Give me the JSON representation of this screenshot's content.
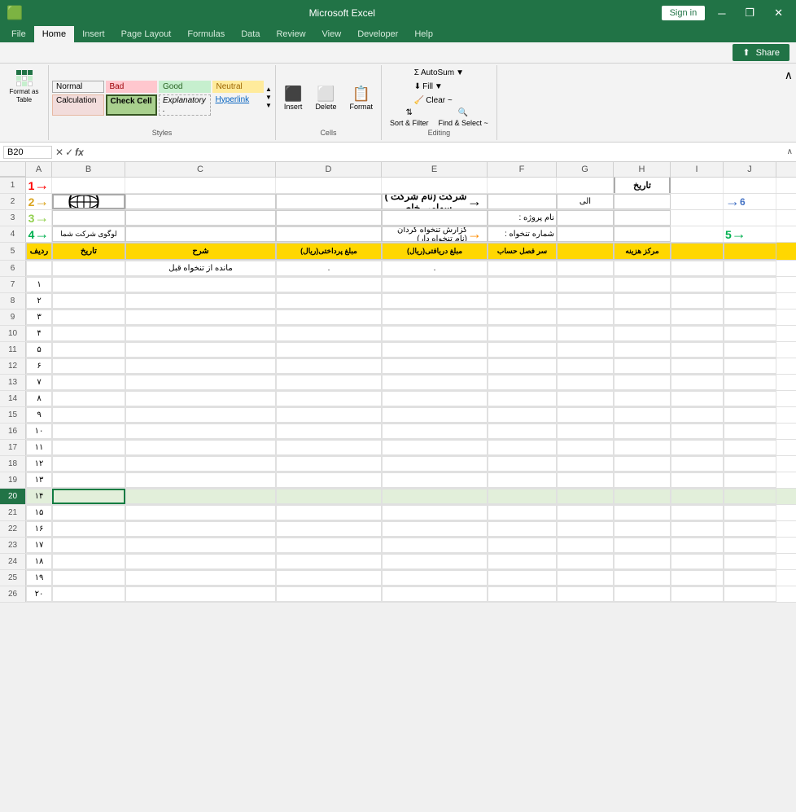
{
  "titlebar": {
    "app": "Microsoft Excel",
    "sign_in": "Sign in",
    "minimize": "─",
    "restore": "❐",
    "close": "✕"
  },
  "ribbon": {
    "tabs": [
      "File",
      "Home",
      "Insert",
      "Page Layout",
      "Formulas",
      "Data",
      "Review",
      "View",
      "Developer",
      "Help"
    ],
    "active_tab": "Home",
    "share_label": "Share",
    "groups": {
      "format_table": "Format as\nTable",
      "styles_label": "Styles",
      "cells_label": "Cells",
      "editing_label": "Editing"
    },
    "styles": {
      "normal": "Normal",
      "bad": "Bad",
      "good": "Good",
      "neutral": "Neutral",
      "calculation": "Calculation",
      "check_cell": "Check Cell",
      "explanatory": "Explanatory .",
      "hyperlink": "Hyperlink"
    },
    "cells": {
      "insert": "Insert",
      "delete": "Delete",
      "format": "Format"
    },
    "editing": {
      "autosum": "AutoSum",
      "fill": "Fill",
      "clear": "Clear ~",
      "sort_filter": "Sort &\nFilter",
      "find_select": "Find &\nSelect ~"
    }
  },
  "formula_bar": {
    "name_box": "B20",
    "formula": ""
  },
  "spreadsheet": {
    "columns": [
      "A",
      "B",
      "C",
      "D",
      "E",
      "F",
      "G",
      "H",
      "I",
      "J"
    ],
    "rows": {
      "1": {
        "a": "1",
        "b": "",
        "c": "",
        "d": "",
        "e": "",
        "f": "",
        "g": "",
        "h": "تاریخ",
        "i": "",
        "j": ""
      },
      "2": {
        "a": "2",
        "b": "",
        "c": "",
        "d": "",
        "e": "شرکت (نام شرکت ) سهامی خاص",
        "f": "",
        "g": "الی",
        "h": "",
        "i": "",
        "j": ""
      },
      "3": {
        "a": "3",
        "b": "",
        "c": "",
        "d": "",
        "e": "",
        "f": "نام پروژه :",
        "g": "",
        "h": "",
        "i": "",
        "j": ""
      },
      "4": {
        "a": "4",
        "b": "لوگوی شرکت شما",
        "c": "",
        "d": "",
        "e": "گزارش تنخواه گردان (نام تنخواه دار)",
        "f": "شماره تنخواه :",
        "g": "",
        "h": "",
        "i": "",
        "j": ""
      },
      "5": {
        "a": "ردیف",
        "b": "تاریخ",
        "c": "شرح",
        "d": "مبلغ پرداختی(ریال)",
        "e": "مبلغ دریافتی(ریال)",
        "f": "سر فصل حساب",
        "g": "",
        "h": "مرکز هزینه",
        "i": "",
        "j": ""
      },
      "6": {
        "a": "",
        "b": "",
        "c": "مانده از تنخواه قبل",
        "d": ".",
        "e": ".",
        "f": "",
        "g": "",
        "h": "",
        "i": "",
        "j": ""
      },
      "7": {
        "a": "۱",
        "b": "",
        "c": "",
        "d": "",
        "e": "",
        "f": "",
        "g": "",
        "h": "",
        "i": "",
        "j": ""
      },
      "8": {
        "a": "۲",
        "b": "",
        "c": "",
        "d": "",
        "e": "",
        "f": "",
        "g": "",
        "h": "",
        "i": "",
        "j": ""
      },
      "9": {
        "a": "۳",
        "b": "",
        "c": "",
        "d": "",
        "e": "",
        "f": "",
        "g": "",
        "h": "",
        "i": "",
        "j": ""
      },
      "10": {
        "a": "۴",
        "b": "",
        "c": "",
        "d": "",
        "e": "",
        "f": "",
        "g": "",
        "h": "",
        "i": "",
        "j": ""
      },
      "11": {
        "a": "۵",
        "b": "",
        "c": "",
        "d": "",
        "e": "",
        "f": "",
        "g": "",
        "h": "",
        "i": "",
        "j": ""
      },
      "12": {
        "a": "۶",
        "b": "",
        "c": "",
        "d": "",
        "e": "",
        "f": "",
        "g": "",
        "h": "",
        "i": "",
        "j": ""
      },
      "13": {
        "a": "۷",
        "b": "",
        "c": "",
        "d": "",
        "e": "",
        "f": "",
        "g": "",
        "h": "",
        "i": "",
        "j": ""
      },
      "14": {
        "a": "۸",
        "b": "",
        "c": "",
        "d": "",
        "e": "",
        "f": "",
        "g": "",
        "h": "",
        "i": "",
        "j": ""
      },
      "15": {
        "a": "۹",
        "b": "",
        "c": "",
        "d": "",
        "e": "",
        "f": "",
        "g": "",
        "h": "",
        "i": "",
        "j": ""
      },
      "16": {
        "a": "۱۰",
        "b": "",
        "c": "",
        "d": "",
        "e": "",
        "f": "",
        "g": "",
        "h": "",
        "i": "",
        "j": ""
      },
      "17": {
        "a": "۱۱",
        "b": "",
        "c": "",
        "d": "",
        "e": "",
        "f": "",
        "g": "",
        "h": "",
        "i": "",
        "j": ""
      },
      "18": {
        "a": "۱۲",
        "b": "",
        "c": "",
        "d": "",
        "e": "",
        "f": "",
        "g": "",
        "h": "",
        "i": "",
        "j": ""
      },
      "19": {
        "a": "۱۳",
        "b": "",
        "c": "",
        "d": "",
        "e": "",
        "f": "",
        "g": "",
        "h": "",
        "i": "",
        "j": ""
      },
      "20": {
        "a": "۱۴",
        "b": "",
        "c": "",
        "d": "",
        "e": "",
        "f": "",
        "g": "",
        "h": "",
        "i": "",
        "j": ""
      },
      "21": {
        "a": "۱۵",
        "b": "",
        "c": "",
        "d": "",
        "e": "",
        "f": "",
        "g": "",
        "h": "",
        "i": "",
        "j": ""
      },
      "22": {
        "a": "۱۶",
        "b": "",
        "c": "",
        "d": "",
        "e": "",
        "f": "",
        "g": "",
        "h": "",
        "i": "",
        "j": ""
      },
      "23": {
        "a": "۱۷",
        "b": "",
        "c": "",
        "d": "",
        "e": "",
        "f": "",
        "g": "",
        "h": "",
        "i": "",
        "j": ""
      },
      "24": {
        "a": "۱۸",
        "b": "",
        "c": "",
        "d": "",
        "e": "",
        "f": "",
        "g": "",
        "h": "",
        "i": "",
        "j": ""
      },
      "25": {
        "a": "۱۹",
        "b": "",
        "c": "",
        "d": "",
        "e": "",
        "f": "",
        "g": "",
        "h": "",
        "i": "",
        "j": ""
      },
      "26": {
        "a": "۲۰",
        "b": "",
        "c": "",
        "d": "",
        "e": "",
        "f": "",
        "g": "",
        "h": "",
        "i": "",
        "j": ""
      }
    },
    "row_numbers": [
      1,
      2,
      3,
      4,
      5,
      6,
      7,
      8,
      9,
      10,
      11,
      12,
      13,
      14,
      15,
      16,
      17,
      18,
      19,
      20,
      21,
      22,
      23,
      24,
      25,
      26
    ],
    "labels": {
      "arrow1": "1",
      "arrow2": "2",
      "arrow3": "3",
      "arrow4": "4",
      "arrow5": "5",
      "arrow6": "6"
    }
  }
}
